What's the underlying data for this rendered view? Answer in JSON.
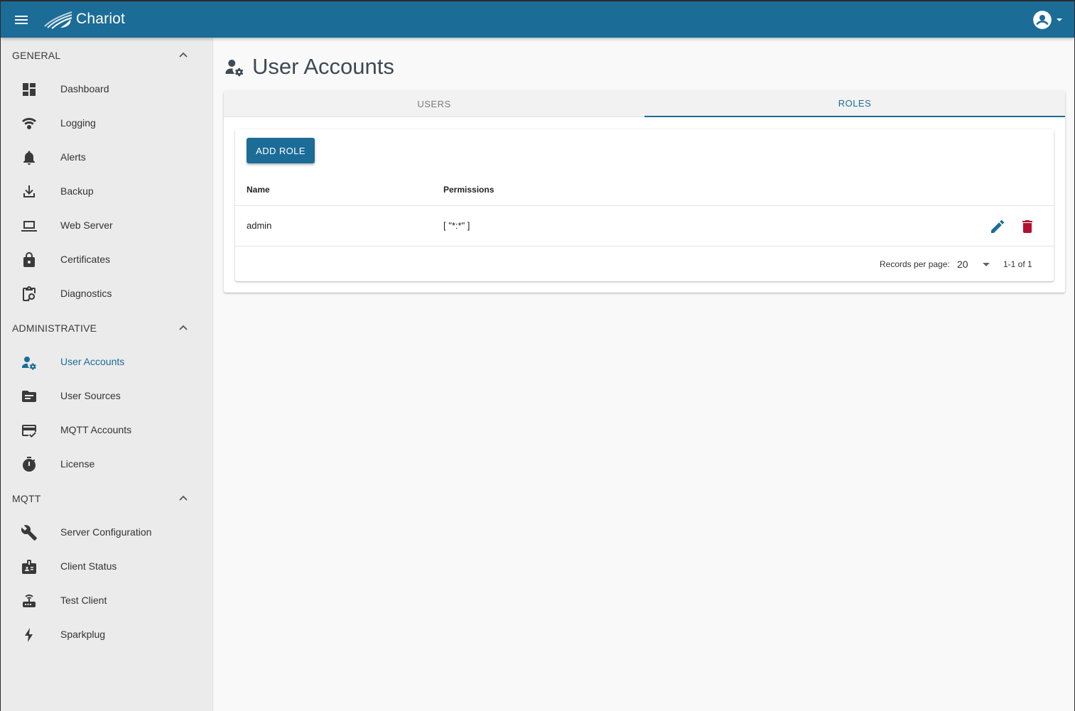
{
  "app": {
    "title": "Chariot"
  },
  "colors": {
    "primary": "#1c6c98",
    "danger": "#b3102f",
    "sidebar_bg": "#ebebeb"
  },
  "sidebar": {
    "sections": [
      {
        "label": "GENERAL",
        "items": [
          {
            "label": "Dashboard",
            "icon": "dashboard-icon"
          },
          {
            "label": "Logging",
            "icon": "logging-icon"
          },
          {
            "label": "Alerts",
            "icon": "bell-icon"
          },
          {
            "label": "Backup",
            "icon": "download-icon"
          },
          {
            "label": "Web Server",
            "icon": "laptop-icon"
          },
          {
            "label": "Certificates",
            "icon": "lock-icon"
          },
          {
            "label": "Diagnostics",
            "icon": "clipboard-search-icon"
          }
        ]
      },
      {
        "label": "ADMINISTRATIVE",
        "items": [
          {
            "label": "User Accounts",
            "icon": "user-cog-icon",
            "active": true
          },
          {
            "label": "User Sources",
            "icon": "folder-icon"
          },
          {
            "label": "MQTT Accounts",
            "icon": "card-check-icon"
          },
          {
            "label": "License",
            "icon": "stopwatch-icon"
          }
        ]
      },
      {
        "label": "MQTT",
        "items": [
          {
            "label": "Server Configuration",
            "icon": "wrench-icon"
          },
          {
            "label": "Client Status",
            "icon": "id-badge-icon"
          },
          {
            "label": "Test Client",
            "icon": "router-icon"
          },
          {
            "label": "Sparkplug",
            "icon": "lightning-icon"
          }
        ]
      }
    ]
  },
  "page": {
    "title": "User Accounts",
    "icon": "user-cog-icon"
  },
  "tabs": [
    {
      "label": "USERS",
      "active": false
    },
    {
      "label": "ROLES",
      "active": true
    }
  ],
  "roles": {
    "add_button": "ADD ROLE",
    "columns": {
      "name": "Name",
      "permissions": "Permissions"
    },
    "rows": [
      {
        "name": "admin",
        "permissions": "[ \"*:*\" ]"
      }
    ],
    "footer": {
      "records_label": "Records per page:",
      "records_value": "20",
      "range": "1-1 of 1"
    }
  }
}
